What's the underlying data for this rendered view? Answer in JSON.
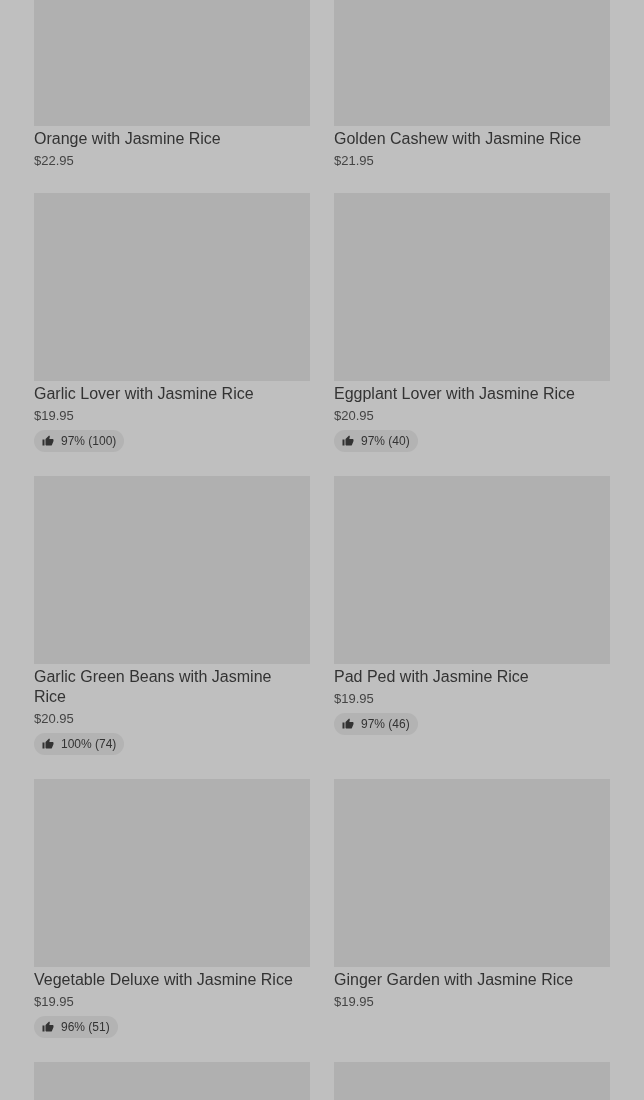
{
  "items": [
    {
      "name": "Orange with Jasmine Rice",
      "price": "$22.95"
    },
    {
      "name": "Golden Cashew with Jasmine Rice",
      "price": "$21.95"
    },
    {
      "name": "Garlic Lover with Jasmine Rice",
      "price": "$19.95",
      "rating": "97% (100)"
    },
    {
      "name": "Eggplant Lover with Jasmine Rice",
      "price": "$20.95",
      "rating": "97% (40)"
    },
    {
      "name": "Garlic Green Beans with Jasmine Rice",
      "price": "$20.95",
      "rating": "100% (74)"
    },
    {
      "name": "Pad Ped with Jasmine Rice",
      "price": "$19.95",
      "rating": "97% (46)"
    },
    {
      "name": "Vegetable Deluxe with Jasmine Rice",
      "price": "$19.95",
      "rating": "96% (51)"
    },
    {
      "name": "Ginger Garden with Jasmine Rice",
      "price": "$19.95"
    }
  ]
}
